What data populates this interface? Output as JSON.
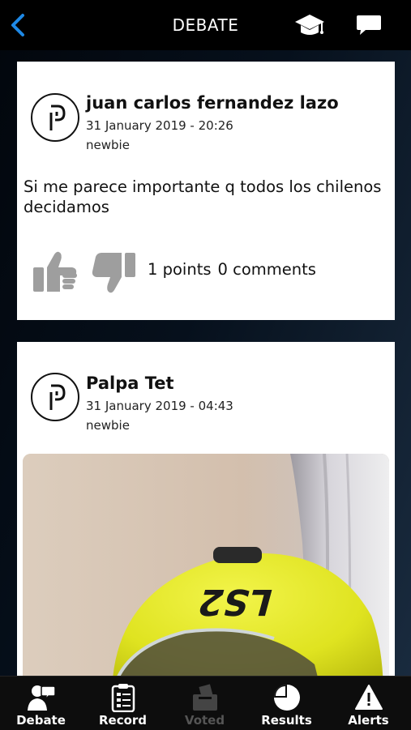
{
  "header": {
    "title": "DEBATE",
    "back_icon": "chevron-left-icon",
    "accent": "#1e88e5"
  },
  "posts": [
    {
      "author": "juan carlos fernandez lazo",
      "date": "31 January 2019 - 20:26",
      "level": "newbie",
      "text": "Si me parece importante q todos los chilenos decidamos",
      "points": "1 points",
      "comments": "0 comments"
    },
    {
      "author": "Palpa Tet",
      "date": "31 January 2019 - 04:43",
      "level": "newbie",
      "image_text": "LS2"
    }
  ],
  "tabs": [
    {
      "label": "Debate",
      "icon": "debate-icon",
      "enabled": true
    },
    {
      "label": "Record",
      "icon": "clipboard-icon",
      "enabled": true
    },
    {
      "label": "Voted",
      "icon": "ballot-box-icon",
      "enabled": false
    },
    {
      "label": "Results",
      "icon": "pie-chart-icon",
      "enabled": true
    },
    {
      "label": "Alerts",
      "icon": "warning-icon",
      "enabled": true
    }
  ]
}
